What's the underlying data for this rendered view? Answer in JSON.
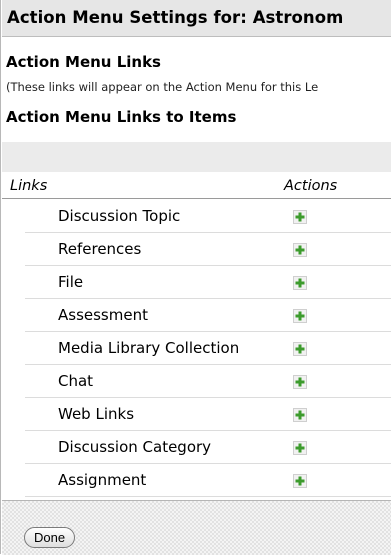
{
  "header": {
    "title": "Action Menu Settings for: Astronom"
  },
  "links_section": {
    "title": "Action Menu Links",
    "note": "(These links will appear on the Action Menu for this Le"
  },
  "items_section": {
    "title": "Action Menu Links to Items"
  },
  "table": {
    "col_links": "Links",
    "col_actions": "Actions",
    "rows": [
      {
        "label": "Discussion Topic",
        "action_icon": "add-icon"
      },
      {
        "label": "References",
        "action_icon": "add-icon"
      },
      {
        "label": "File",
        "action_icon": "add-icon"
      },
      {
        "label": "Assessment",
        "action_icon": "add-icon"
      },
      {
        "label": "Media Library Collection",
        "action_icon": "add-icon"
      },
      {
        "label": "Chat",
        "action_icon": "add-icon"
      },
      {
        "label": "Web Links",
        "action_icon": "add-icon"
      },
      {
        "label": "Discussion Category",
        "action_icon": "add-icon"
      },
      {
        "label": "Assignment",
        "action_icon": "add-icon"
      }
    ]
  },
  "footer": {
    "done_label": "Done"
  },
  "colors": {
    "add_icon_green": "#3c9b2c",
    "header_bg": "#e6e6e6"
  }
}
